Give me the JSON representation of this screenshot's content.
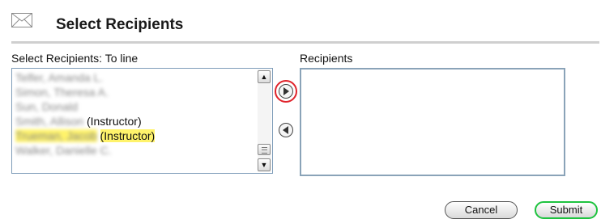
{
  "header": {
    "title": "Select Recipients",
    "icon": "envelope-icon"
  },
  "left_list": {
    "label": "Select Recipients: To line",
    "items": [
      {
        "name": "Telfer, Amanda L.",
        "role": ""
      },
      {
        "name": "Simon, Theresa A.",
        "role": ""
      },
      {
        "name": "Sun, Donald",
        "role": ""
      },
      {
        "name": "Smith, Allison",
        "role": "(Instructor)"
      },
      {
        "name": "Trueman, Jacob",
        "role": "(Instructor)",
        "highlighted": true
      },
      {
        "name": "Walker, Danielle C.",
        "role": ""
      }
    ]
  },
  "right_list": {
    "label": "Recipients",
    "items": []
  },
  "controls": {
    "add_icon": "arrow-right-circle-icon",
    "remove_icon": "arrow-left-circle-icon"
  },
  "buttons": {
    "cancel": "Cancel",
    "submit": "Submit"
  },
  "colors": {
    "highlight": "#fff36b",
    "focus_red": "#e0232b",
    "focus_green": "#1ec33f"
  }
}
